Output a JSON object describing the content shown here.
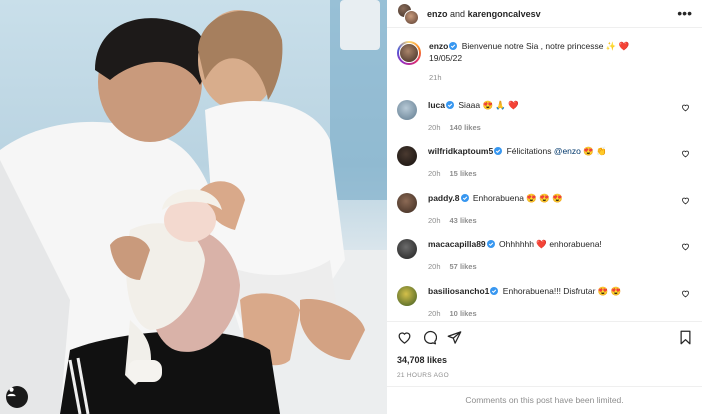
{
  "header": {
    "user1": "enzo",
    "joiner": "and",
    "user2": "karengoncalvesv",
    "more_icon": "more-horizontal-icon"
  },
  "caption": {
    "username": "enzo",
    "text": "Bienvenue notre Sia , notre princesse ✨ ❤️",
    "date_line": "19/05/22",
    "time": "21h"
  },
  "comments": [
    {
      "username": "luca",
      "verified": true,
      "text": "Siaaa 😍 🙏 ❤️",
      "time": "20h",
      "likes": "140 likes",
      "avatar_color": "#8aa3b8"
    },
    {
      "username": "wilfridkaptoum5",
      "verified": true,
      "text": "Félicitations ",
      "mention": "@enzo",
      "tail": " 😍 👏",
      "time": "20h",
      "likes": "15 likes",
      "avatar_color": "#2b2420"
    },
    {
      "username": "paddy.8",
      "verified": true,
      "text": "Enhorabuena 😍 😍 😍",
      "time": "20h",
      "likes": "43 likes",
      "avatar_color": "#5e4636"
    },
    {
      "username": "macacapilla89",
      "verified": true,
      "text": "Ohhhhhh ❤️ enhorabuena!",
      "time": "20h",
      "likes": "57 likes",
      "avatar_color": "#3b3b3b"
    },
    {
      "username": "basiliosancho1",
      "verified": true,
      "text": "Enhorabuena!!! Disfrutar 😍 😍",
      "time": "20h",
      "likes": "10 likes",
      "avatar_color": "#4a6a2a"
    }
  ],
  "stats": {
    "likes": "34,708 likes",
    "ago": "21 HOURS AGO"
  },
  "footer": {
    "limited": "Comments on this post have been limited."
  },
  "colors": {
    "verified": "#3897f0",
    "meta": "#8e8e8e",
    "text": "#262626"
  }
}
